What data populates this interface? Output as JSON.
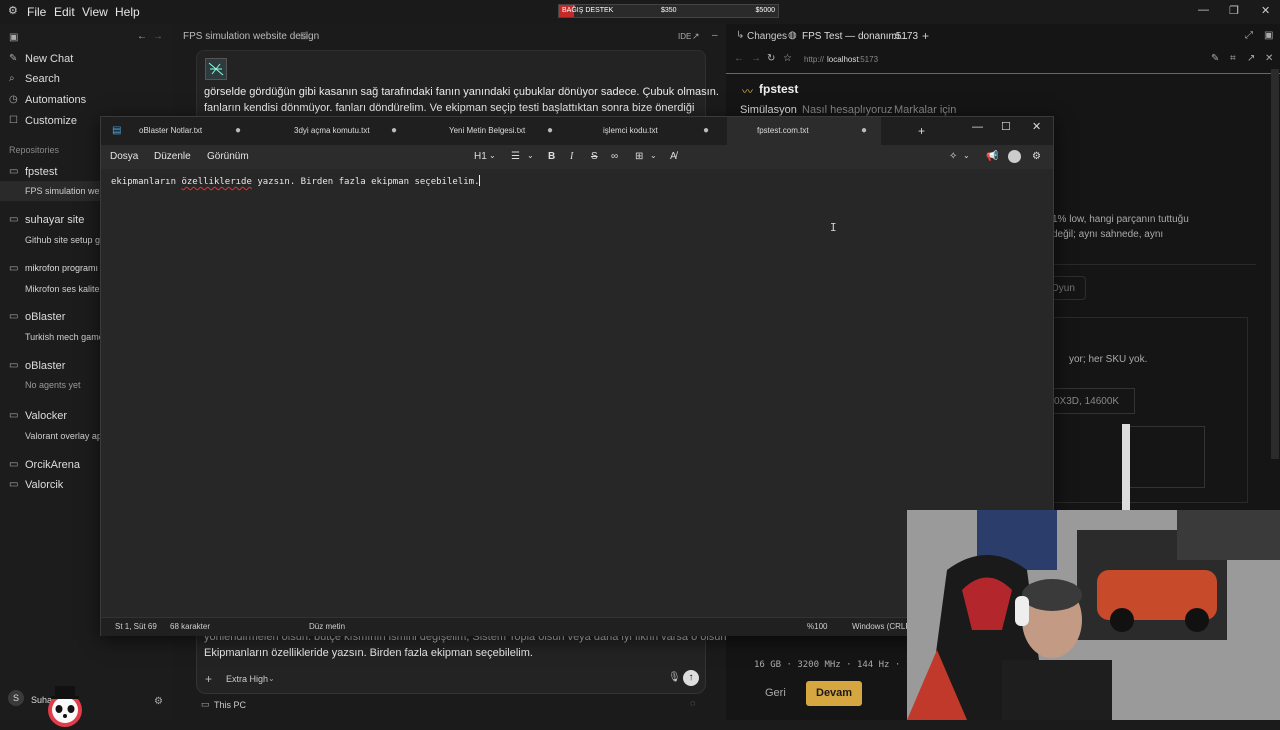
{
  "top_menu": {
    "file": "File",
    "edit": "Edit",
    "view": "View",
    "help": "Help"
  },
  "donation": {
    "label": "BAĞIŞ DESTEK",
    "current": "$350",
    "goal": "$5000",
    "progress": 0.07
  },
  "sidebar": {
    "new_chat": "New Chat",
    "search": "Search",
    "automations": "Automations",
    "customize": "Customize",
    "repositories_label": "Repositories",
    "repos": [
      {
        "name": "fpstest",
        "sub": "FPS simulation webs"
      },
      {
        "name": "suhayar site",
        "sub": "Github site setup gu"
      },
      {
        "name": "mikrofon programı",
        "sub": "Mikrofon ses kalites"
      },
      {
        "name": "oBlaster",
        "sub": "Turkish mech game"
      },
      {
        "name": "oBlaster",
        "sub": "No agents yet"
      },
      {
        "name": "Valocker",
        "sub": "Valorant overlay app"
      },
      {
        "name": "OrcikArena",
        "sub": ""
      },
      {
        "name": "Valorcik",
        "sub": ""
      }
    ],
    "user_initial": "S",
    "user_name": "Suha"
  },
  "chat": {
    "title": "FPS simulation website design",
    "ide": "IDE",
    "line1": "görselde gördüğün gibi kasanın sağ tarafındaki fanın yanındaki çubuklar dönüyor sadece. Çubuk olmasın.",
    "line2": "fanların kendisi dönmüyor. fanları döndürelim.  Ve ekipman seçip testi başlattıktan sonra bize önerdiği",
    "line3": "yönlendirmeleri olsun. bütçe kısmının ismini değişelim, Sistem Topla olsun veya daha iyi fikrin varsa o olsun.",
    "line4": "Ekipmanların özellikleride yazsın. Birden fazla ekipman seçebilelim.",
    "reasoning": "Extra High",
    "env": "This PC"
  },
  "preview": {
    "changes": "Changes",
    "tab_title": "FPS Test — donanımı...",
    "tab_port": ":5173",
    "url_prefix": "http://",
    "url_host": "localhost",
    "url_port": ":5173",
    "brand": "fpstest",
    "nav": [
      "Simülasyon",
      "Nasıl hesaplıyoruz",
      "Markalar için"
    ],
    "snip1": "1% low, hangi parçanın tuttuğu",
    "snip2": " değil; aynı sahnede, aynı",
    "snip3": "Oyun",
    "snip4": "yor; her SKU yok.",
    "snip5": "0X3D, 14600K",
    "specs": "16 GB · 3200 MHz · 144 Hz · 1",
    "back": "Geri",
    "next": "Devam"
  },
  "notepad": {
    "tabs": [
      "oBlaster Notlar.txt",
      "3dyi açma komutu.txt",
      "Yeni Metin Belgesi.txt",
      "işlemci kodu.txt",
      "fpstest.com.txt"
    ],
    "menu": [
      "Dosya",
      "Düzenle",
      "Görünüm"
    ],
    "heading": "H1",
    "text_a": "ekipmanların ",
    "text_b": "özelliklerıde",
    "text_c": " yazsın. Birden fazla ekipman seçebilelim.",
    "status": {
      "position": "St 1, Süt 69",
      "chars": "68 karakter",
      "format": "Düz metin",
      "zoom": "%100",
      "eol": "Windows (CRLF)"
    }
  }
}
